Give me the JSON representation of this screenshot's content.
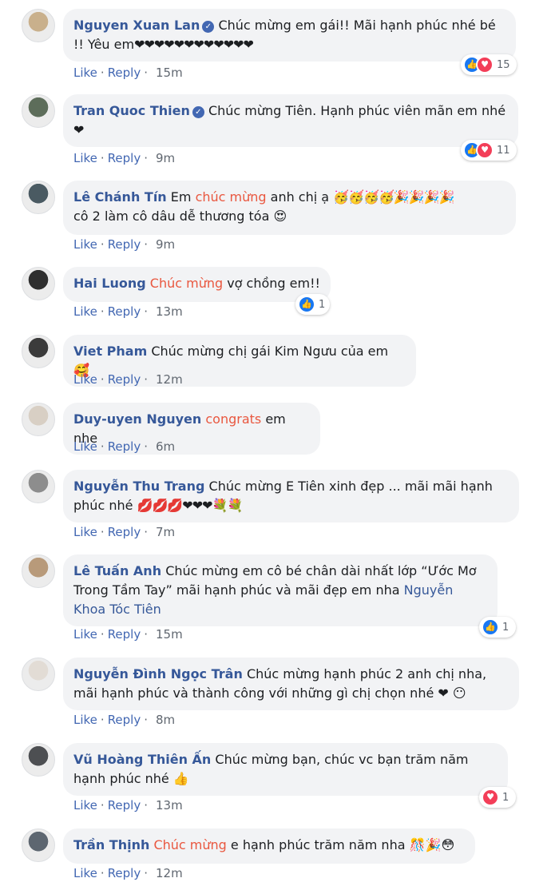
{
  "actions": {
    "like": "Like",
    "reply": "Reply",
    "sep": "·"
  },
  "comments": [
    {
      "author": "Nguyen Xuan Lan",
      "verified": true,
      "segments": [
        {
          "t": "Chúc mừng em gái!! Mãi hạnh phúc nhé bé !! Yêu em"
        }
      ],
      "emoji": "❤❤❤❤❤❤❤❤❤❤❤❤",
      "time": "15m",
      "reactions": {
        "icons": [
          "like-icon",
          "love-icon"
        ],
        "count": "15"
      }
    },
    {
      "author": "Tran Quoc Thien",
      "verified": true,
      "segments": [
        {
          "t": "Chúc mừng Tiên. Hạnh phúc viên mãn em nhé"
        }
      ],
      "emoji": "❤",
      "time": "9m",
      "reactions": {
        "icons": [
          "like-icon",
          "love-icon"
        ],
        "count": "11"
      }
    },
    {
      "author": "Lê Chánh Tín",
      "segments": [
        {
          "t": "Em "
        },
        {
          "t": "chúc mừng",
          "hl": true
        },
        {
          "t": " anh chị ạ "
        }
      ],
      "emoji": "🥳🥳🥳🥳🎉🎉🎉🎉",
      "after": "cô 2 làm cô dâu dễ thương tóa 😍",
      "time": "9m"
    },
    {
      "author": "Hai Luong",
      "segments": [
        {
          "t": "Chúc mừng",
          "hl": true
        },
        {
          "t": " vợ chồng em!!"
        }
      ],
      "time": "13m",
      "reactions": {
        "icons": [
          "like-icon"
        ],
        "count": "1"
      }
    },
    {
      "author": "Viet Pham",
      "segments": [
        {
          "t": "Chúc mừng chị gái Kim Ngưu của em 🥰"
        }
      ],
      "time": "12m"
    },
    {
      "author": "Duy-uyen Nguyen",
      "segments": [
        {
          "t": "congrats",
          "hl": true
        },
        {
          "t": " em nhe"
        }
      ],
      "time": "6m"
    },
    {
      "author": "Nguyễn Thu Trang",
      "segments": [
        {
          "t": "Chúc mừng E Tiên xinh đẹp ... mãi mãi hạnh phúc nhé "
        }
      ],
      "emoji": "💋💋💋❤❤❤💐💐",
      "time": "7m"
    },
    {
      "author": "Lê Tuấn Anh",
      "segments": [
        {
          "t": "Chúc mừng em cô bé chân dài nhất lớp “Ước Mơ Trong Tầm Tay” mãi hạnh phúc và mãi đẹp em nha "
        },
        {
          "t": "Nguyễn Khoa Tóc Tiên",
          "link": true
        }
      ],
      "time": "15m",
      "reactions": {
        "icons": [
          "like-icon"
        ],
        "count": "1"
      }
    },
    {
      "author": "Nguyễn Đình Ngọc Trân",
      "segments": [
        {
          "t": "Chúc mừng hạnh phúc 2 anh chị nha, mãi hạnh phúc và thành công với những gì chị chọn nhé ❤ 😶"
        }
      ],
      "time": "8m"
    },
    {
      "author": "Vũ Hoàng Thiên Ấn",
      "segments": [
        {
          "t": "Chúc mừng bạn, chúc vc bạn trăm năm hạnh phúc nhé 👍"
        }
      ],
      "time": "13m",
      "reactions": {
        "icons": [
          "love-icon"
        ],
        "count": "1"
      }
    },
    {
      "author": "Trần Thịnh",
      "segments": [
        {
          "t": "Chúc mừng",
          "hl": true
        },
        {
          "t": " e hạnh phúc trăm năm nha 🎊🎉😳"
        }
      ],
      "time": "12m"
    }
  ],
  "colors": {
    "author": "#365899",
    "highlight": "#e9573f",
    "action": "#4267b2",
    "bubble": "#f2f3f5",
    "like": "#1877f2",
    "love": "#f33e58"
  }
}
